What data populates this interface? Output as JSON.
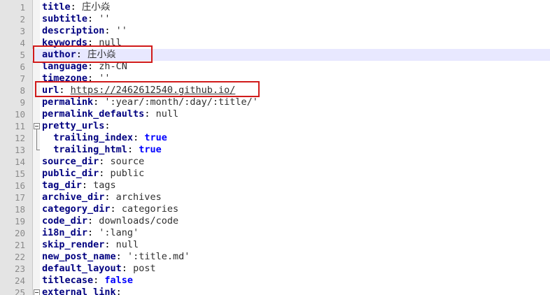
{
  "editor": {
    "lines": [
      {
        "n": "1",
        "indent": "",
        "key": "title",
        "sep": ": ",
        "value": "庄小焱",
        "vtype": "val"
      },
      {
        "n": "2",
        "indent": "",
        "key": "subtitle",
        "sep": ": ",
        "value": "''",
        "vtype": "val"
      },
      {
        "n": "3",
        "indent": "",
        "key": "description",
        "sep": ": ",
        "value": "''",
        "vtype": "val"
      },
      {
        "n": "4",
        "indent": "",
        "key": "keywords",
        "sep": ": ",
        "value": "null",
        "vtype": "val"
      },
      {
        "n": "5",
        "indent": "",
        "key": "author",
        "sep": ": ",
        "value": "庄小焱",
        "vtype": "val",
        "current": true
      },
      {
        "n": "6",
        "indent": "",
        "key": "language",
        "sep": ": ",
        "value": "zh-CN",
        "vtype": "val"
      },
      {
        "n": "7",
        "indent": "",
        "key": "timezone",
        "sep": ": ",
        "value": "''",
        "vtype": "val"
      },
      {
        "n": "8",
        "indent": "",
        "key": "url",
        "sep": ": ",
        "value": "https://2462612540.github.io/",
        "vtype": "url"
      },
      {
        "n": "9",
        "indent": "",
        "key": "permalink",
        "sep": ": ",
        "value": "':year/:month/:day/:title/'",
        "vtype": "val"
      },
      {
        "n": "10",
        "indent": "",
        "key": "permalink_defaults",
        "sep": ": ",
        "value": "null",
        "vtype": "val"
      },
      {
        "n": "11",
        "indent": "",
        "key": "pretty_urls",
        "sep": ":",
        "value": "",
        "vtype": "val",
        "fold": "start"
      },
      {
        "n": "12",
        "indent": "  ",
        "key": "trailing_index",
        "sep": ": ",
        "value": "true",
        "vtype": "bool",
        "fold": "mid"
      },
      {
        "n": "13",
        "indent": "  ",
        "key": "trailing_html",
        "sep": ": ",
        "value": "true",
        "vtype": "bool",
        "fold": "end"
      },
      {
        "n": "14",
        "indent": "",
        "key": "source_dir",
        "sep": ": ",
        "value": "source",
        "vtype": "val"
      },
      {
        "n": "15",
        "indent": "",
        "key": "public_dir",
        "sep": ": ",
        "value": "public",
        "vtype": "val"
      },
      {
        "n": "16",
        "indent": "",
        "key": "tag_dir",
        "sep": ": ",
        "value": "tags",
        "vtype": "val"
      },
      {
        "n": "17",
        "indent": "",
        "key": "archive_dir",
        "sep": ": ",
        "value": "archives",
        "vtype": "val"
      },
      {
        "n": "18",
        "indent": "",
        "key": "category_dir",
        "sep": ": ",
        "value": "categories",
        "vtype": "val"
      },
      {
        "n": "19",
        "indent": "",
        "key": "code_dir",
        "sep": ": ",
        "value": "downloads/code",
        "vtype": "val"
      },
      {
        "n": "20",
        "indent": "",
        "key": "i18n_dir",
        "sep": ": ",
        "value": "':lang'",
        "vtype": "val"
      },
      {
        "n": "21",
        "indent": "",
        "key": "skip_render",
        "sep": ": ",
        "value": "null",
        "vtype": "val"
      },
      {
        "n": "22",
        "indent": "",
        "key": "new_post_name",
        "sep": ": ",
        "value": "':title.md'",
        "vtype": "val"
      },
      {
        "n": "23",
        "indent": "",
        "key": "default_layout",
        "sep": ": ",
        "value": "post",
        "vtype": "val"
      },
      {
        "n": "24",
        "indent": "",
        "key": "titlecase",
        "sep": ": ",
        "value": "false",
        "vtype": "bool"
      },
      {
        "n": "25",
        "indent": "",
        "key": "external_link",
        "sep": ":",
        "value": "",
        "vtype": "val",
        "fold": "start"
      }
    ]
  },
  "colors": {
    "key": "#000080",
    "boolean": "#0000ff",
    "highlight_box": "#d11a1a",
    "current_line": "#e8e8ff",
    "gutter": "#e4e4e4"
  },
  "annotations": [
    {
      "target_line": "5",
      "name": "author-highlight-box"
    },
    {
      "target_line": "8",
      "name": "url-highlight-box"
    }
  ]
}
